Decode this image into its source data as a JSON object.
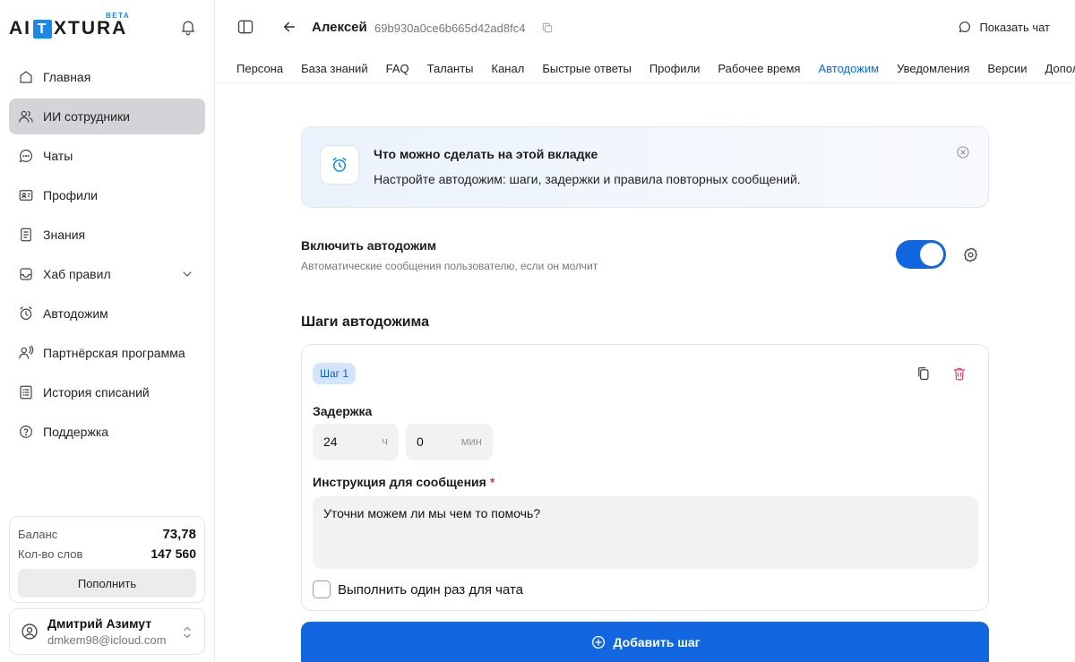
{
  "brand": {
    "logo_left": "AI",
    "logo_box": "T",
    "logo_right": "XTURA",
    "beta": "BETA",
    "accent": "#1266e0"
  },
  "sidebar": {
    "items": [
      {
        "label": "Главная",
        "icon": "home-icon"
      },
      {
        "label": "ИИ сотрудники",
        "icon": "users-icon",
        "active": true
      },
      {
        "label": "Чаты",
        "icon": "chat-icon"
      },
      {
        "label": "Профили",
        "icon": "id-card-icon"
      },
      {
        "label": "Знания",
        "icon": "document-icon"
      },
      {
        "label": "Хаб правил",
        "icon": "inbox-icon",
        "expandable": true
      },
      {
        "label": "Автодожим",
        "icon": "alarm-icon"
      },
      {
        "label": "Партнёрская программа",
        "icon": "partner-icon"
      },
      {
        "label": "История списаний",
        "icon": "list-icon"
      },
      {
        "label": "Поддержка",
        "icon": "help-icon"
      }
    ]
  },
  "balance": {
    "balance_label": "Баланс",
    "balance_value": "73,78",
    "words_label": "Кол-во слов",
    "words_value": "147 560",
    "topup_label": "Пополнить"
  },
  "user": {
    "name": "Дмитрий Азимут",
    "email": "dmkem98@icloud.com"
  },
  "header": {
    "agent_name": "Алексей",
    "agent_id": "69b930a0ce6b665d42ad8fc4",
    "show_chat": "Показать чат"
  },
  "tabs": [
    {
      "label": "Персона"
    },
    {
      "label": "База знаний"
    },
    {
      "label": "FAQ"
    },
    {
      "label": "Таланты"
    },
    {
      "label": "Канал"
    },
    {
      "label": "Быстрые ответы"
    },
    {
      "label": "Профили"
    },
    {
      "label": "Рабочее время"
    },
    {
      "label": "Автодожим",
      "active": true
    },
    {
      "label": "Уведомления"
    },
    {
      "label": "Версии"
    },
    {
      "label": "Допол"
    }
  ],
  "info": {
    "title": "Что можно сделать на этой вкладке",
    "text": "Настройте автодожим: шаги, задержки и правила повторных сообщений."
  },
  "enable": {
    "title": "Включить автодожим",
    "subtitle": "Автоматические сообщения пользователю, если он молчит",
    "enabled": true
  },
  "steps": {
    "title": "Шаги автодожима",
    "items": [
      {
        "badge": "Шаг 1",
        "delay_label": "Задержка",
        "hours_value": "24",
        "hours_unit": "ч",
        "minutes_value": "0",
        "minutes_unit": "мин",
        "instruction_label": "Инструкция для сообщения",
        "required_mark": "*",
        "instruction_value": "Уточни можем ли мы чем то помочь?",
        "once_label": "Выполнить один раз для чата",
        "once_checked": false
      }
    ],
    "add_label": "Добавить шаг"
  }
}
